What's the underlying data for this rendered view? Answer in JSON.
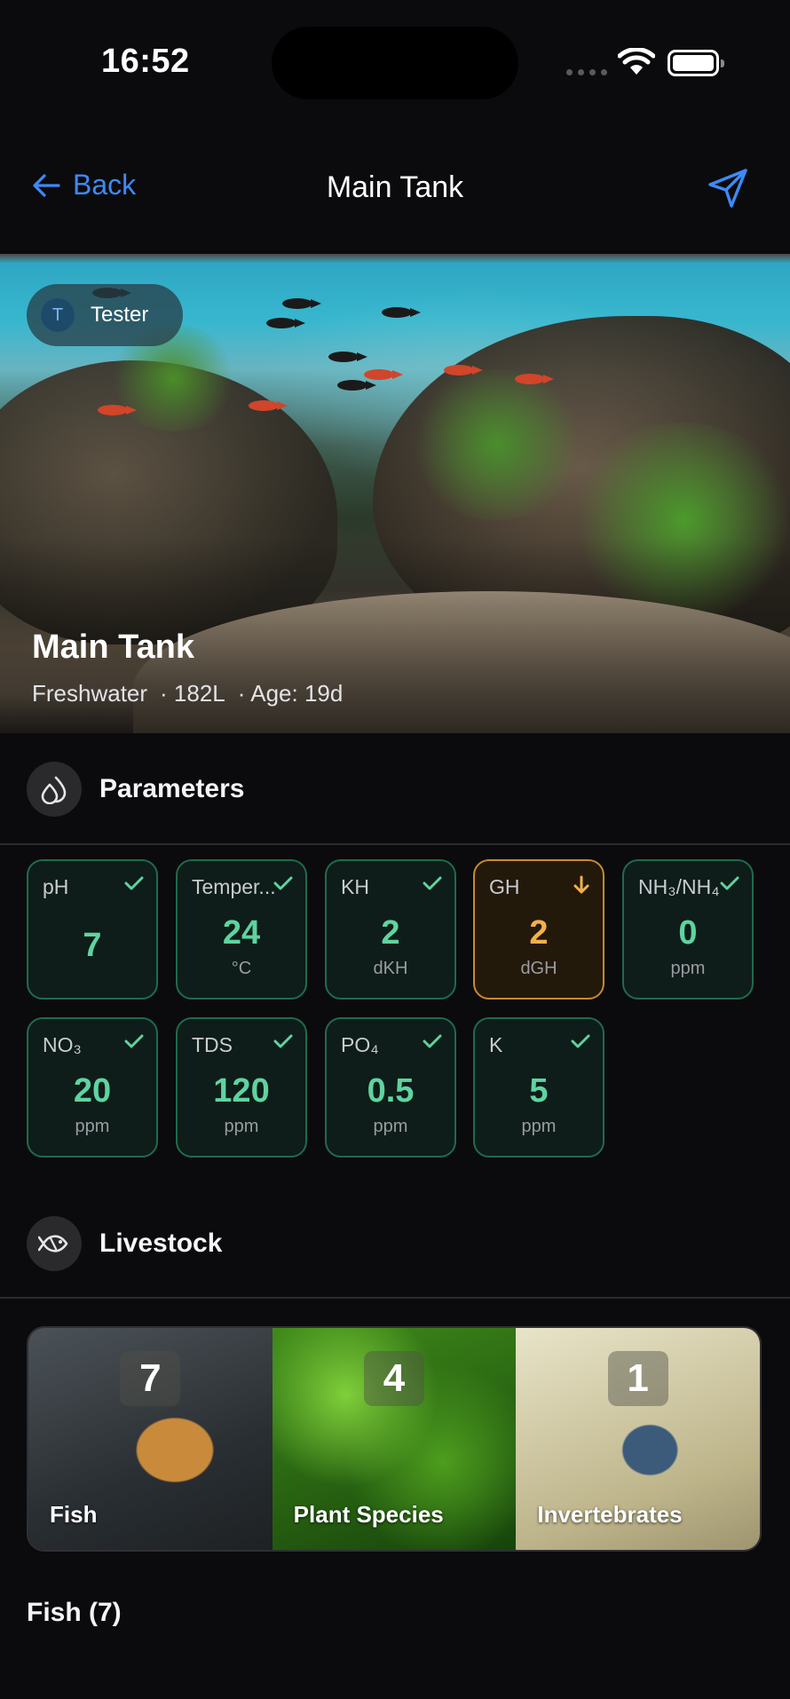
{
  "status_bar": {
    "time": "16:52"
  },
  "nav": {
    "back_label": "Back",
    "title": "Main Tank"
  },
  "hero": {
    "user_initial": "T",
    "user_name": "Tester",
    "tank_name": "Main Tank",
    "water_type": "Freshwater",
    "volume": "· 182L",
    "age": "· Age: 19d"
  },
  "parameters": {
    "title": "Parameters",
    "items": [
      {
        "label": "pH",
        "value": "7",
        "unit": "",
        "status": "ok"
      },
      {
        "label": "Temper...",
        "value": "24",
        "unit": "°C",
        "status": "ok"
      },
      {
        "label": "KH",
        "value": "2",
        "unit": "dKH",
        "status": "ok"
      },
      {
        "label": "GH",
        "value": "2",
        "unit": "dGH",
        "status": "low"
      },
      {
        "label": "NH₃/NH₄",
        "value": "0",
        "unit": "ppm",
        "status": "ok"
      },
      {
        "label": "NO₃",
        "value": "20",
        "unit": "ppm",
        "status": "ok"
      },
      {
        "label": "TDS",
        "value": "120",
        "unit": "ppm",
        "status": "ok"
      },
      {
        "label": "PO₄",
        "value": "0.5",
        "unit": "ppm",
        "status": "ok"
      },
      {
        "label": "K",
        "value": "5",
        "unit": "ppm",
        "status": "ok"
      }
    ]
  },
  "livestock": {
    "title": "Livestock",
    "tiles": [
      {
        "label": "Fish",
        "count": "7"
      },
      {
        "label": "Plant Species",
        "count": "4"
      },
      {
        "label": "Invertebrates",
        "count": "1"
      }
    ]
  },
  "fish_section": {
    "title": "Fish (7)"
  },
  "colors": {
    "accent": "#3d8af7",
    "ok": "#5fd3a0",
    "warn": "#f2b04a",
    "background": "#0b0b0d"
  }
}
